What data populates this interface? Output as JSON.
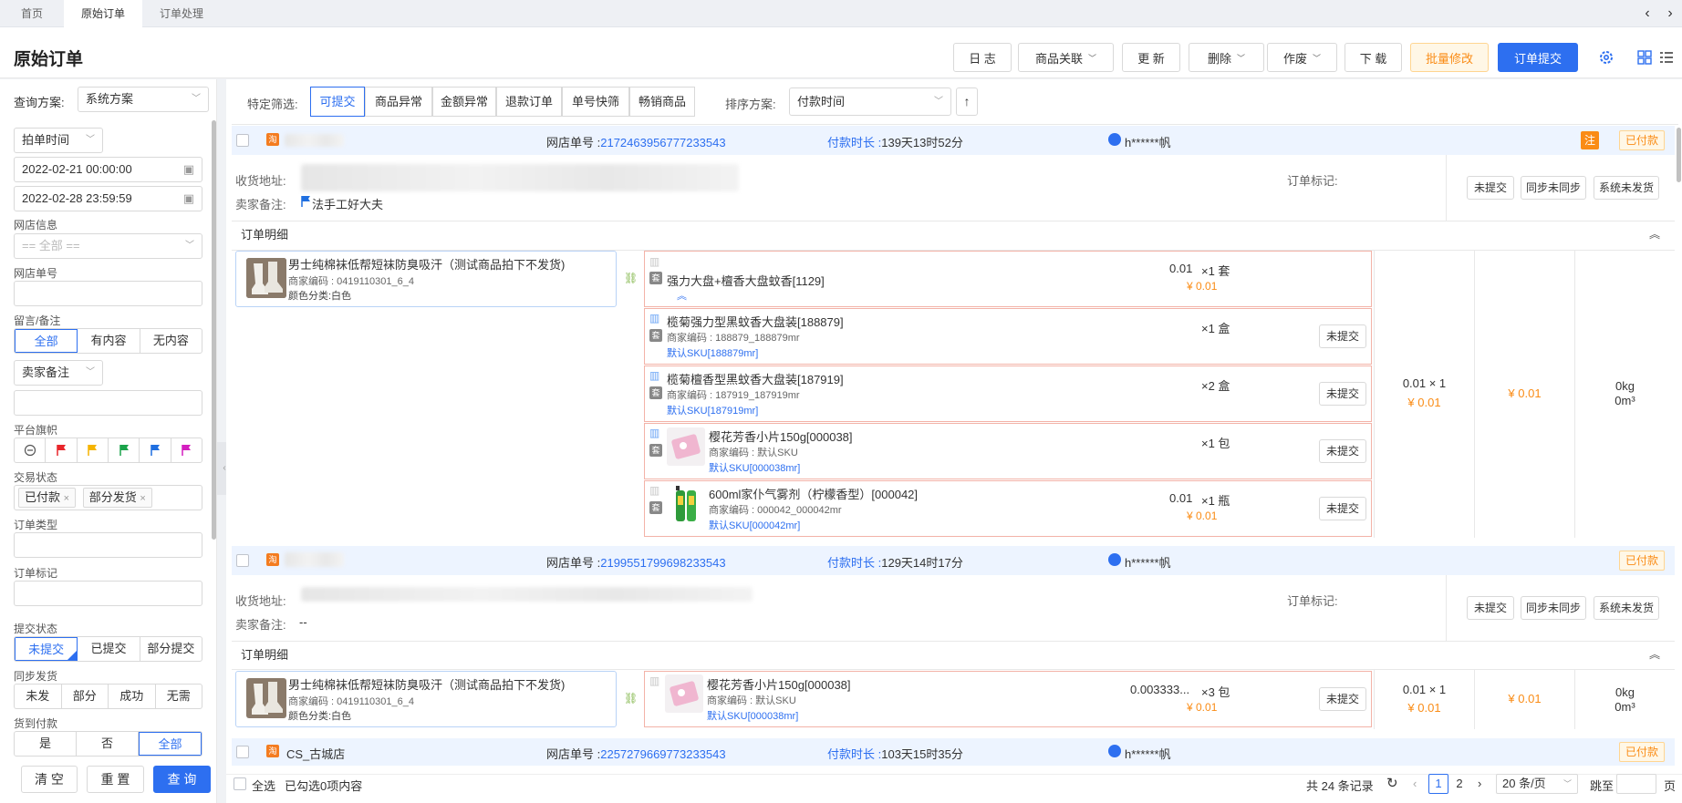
{
  "tabs": [
    {
      "label": "首页"
    },
    {
      "label": "原始订单"
    },
    {
      "label": "订单处理"
    }
  ],
  "page_title": "原始订单",
  "toolbar": {
    "log": "日 志",
    "product_link": "商品关联",
    "update": "更 新",
    "delete": "删除",
    "void": "作废",
    "download": "下 载",
    "batch_modify": "批量修改",
    "submit": "订单提交"
  },
  "sidebar": {
    "scheme_label": "查询方案:",
    "scheme_value": "系统方案",
    "time_type": "拍单时间",
    "date_from": "2022-02-21 00:00:00",
    "date_to": "2022-02-28 23:59:59",
    "shop_label": "网店信息",
    "shop_placeholder": "== 全部 ==",
    "shop_no_label": "网店单号",
    "message_label": "留言/备注",
    "message_opts": [
      "全部",
      "有内容",
      "无内容"
    ],
    "seller_note": "卖家备注",
    "platform_flag_label": "平台旗帜",
    "trade_status_label": "交易状态",
    "trade_status_tags": [
      "已付款",
      "部分发货"
    ],
    "order_type_label": "订单类型",
    "order_mark_label": "订单标记",
    "submit_status_label": "提交状态",
    "submit_status_opts": [
      "未提交",
      "已提交",
      "部分提交"
    ],
    "sync_label": "同步发货",
    "sync_opts": [
      "未发",
      "部分",
      "成功",
      "无需"
    ],
    "cod_label": "货到付款",
    "cod_opts": [
      "是",
      "否",
      "全部"
    ],
    "clear": "清 空",
    "reset": "重 置",
    "query": "查 询"
  },
  "filters": {
    "label": "特定筛选:",
    "opts": [
      "可提交",
      "商品异常",
      "金额异常",
      "退款订单",
      "单号快筛",
      "畅销商品"
    ],
    "sort_label": "排序方案:",
    "sort_value": "付款时间"
  },
  "orders": [
    {
      "shop_no_label": "网店单号 :",
      "shop_no": "2172463956777233543",
      "pay_label": "付款时长 :",
      "pay_duration": "139天13时52分",
      "buyer": "h******帆",
      "status": "已付款",
      "note_tag": "注",
      "address_label": "收货地址:",
      "seller_note_label": "卖家备注:",
      "seller_note": "法手工好大夫",
      "mark_label": "订单标记:",
      "btns": [
        "未提交",
        "同步未同步",
        "系统未发货"
      ],
      "detail_label": "订单明细",
      "main_item": {
        "name": "男士纯棉袜低帮短袜防臭吸汗（测试商品拍下不发货)",
        "code": "商家编码 : 0419110301_6_4",
        "color": "颜色分类:白色"
      },
      "subs": [
        {
          "tao": "套",
          "name": "强力大盘+檀香大盘蚊香[1129]",
          "price": "0.01",
          "qty": "×1 套",
          "amount": "¥ 0.01",
          "btn": ""
        },
        {
          "tao": "套",
          "name": "榄菊强力型黑蚊香大盘装[188879]",
          "code": "商家编码 : 188879_188879mr",
          "sku": "默认SKU[188879mr]",
          "qty": "×1 盒",
          "btn": "未提交"
        },
        {
          "tao": "套",
          "name": "榄菊檀香型黑蚊香大盘装[187919]",
          "code": "商家编码 : 187919_187919mr",
          "sku": "默认SKU[187919mr]",
          "qty": "×2 盒",
          "btn": "未提交"
        },
        {
          "tao": "套",
          "name": "樱花芳香小片150g[000038]",
          "code": "商家编码 : 默认SKU",
          "sku": "默认SKU[000038mr]",
          "qty": "×1 包",
          "btn": "未提交"
        },
        {
          "tao": "套",
          "name": "600ml家仆气雾剂（柠檬香型）[000042]",
          "code": "商家编码 : 000042_000042mr",
          "sku": "默认SKU[000042mr]",
          "price": "0.01",
          "qty": "×1 瓶",
          "amount": "¥ 0.01",
          "btn": "未提交"
        }
      ],
      "col_unit": "0.01 × 1",
      "col_unit_amt": "¥ 0.01",
      "col_total": "¥ 0.01",
      "col_weight": "0kg",
      "col_volume": "0m³"
    },
    {
      "shop_no_label": "网店单号 :",
      "shop_no": "2199551799698233543",
      "pay_label": "付款时长 :",
      "pay_duration": "129天14时17分",
      "buyer": "h******帆",
      "status": "已付款",
      "address_label": "收货地址:",
      "seller_note_label": "卖家备注:",
      "seller_note": "--",
      "mark_label": "订单标记:",
      "btns": [
        "未提交",
        "同步未同步",
        "系统未发货"
      ],
      "detail_label": "订单明细",
      "main_item": {
        "name": "男士纯棉袜低帮短袜防臭吸汗（测试商品拍下不发货)",
        "code": "商家编码 : 0419110301_6_4",
        "color": "颜色分类:白色"
      },
      "sub": {
        "tao": "套",
        "name": "樱花芳香小片150g[000038]",
        "code": "商家编码 : 默认SKU",
        "sku": "默认SKU[000038mr]",
        "price": "0.003333...",
        "qty": "×3 包",
        "amount": "¥ 0.01",
        "btn": "未提交"
      },
      "col_unit": "0.01 × 1",
      "col_unit_amt": "¥ 0.01",
      "col_total": "¥ 0.01",
      "col_weight": "0kg",
      "col_volume": "0m³"
    },
    {
      "shop_name": "CS_古城店",
      "shop_no_label": "网店单号 :",
      "shop_no": "2257279669773233543",
      "pay_label": "付款时长 :",
      "pay_duration": "103天15时35分",
      "buyer": "h******帆",
      "status": "已付款"
    }
  ],
  "footer": {
    "select_all": "全选",
    "selected": "已勾选0项内容",
    "total": "共 24 条记录",
    "pages": [
      "1",
      "2"
    ],
    "page_size": "20 条/页",
    "goto": "跳至",
    "page_unit": "页"
  },
  "colors": {
    "primary": "#2d6ff0",
    "orange": "#fa8c16",
    "flag_red": "#e8262b",
    "flag_yellow": "#f5b400",
    "flag_green": "#1aa34a",
    "flag_blue": "#1f6fe0",
    "flag_purple": "#d41fbf"
  }
}
